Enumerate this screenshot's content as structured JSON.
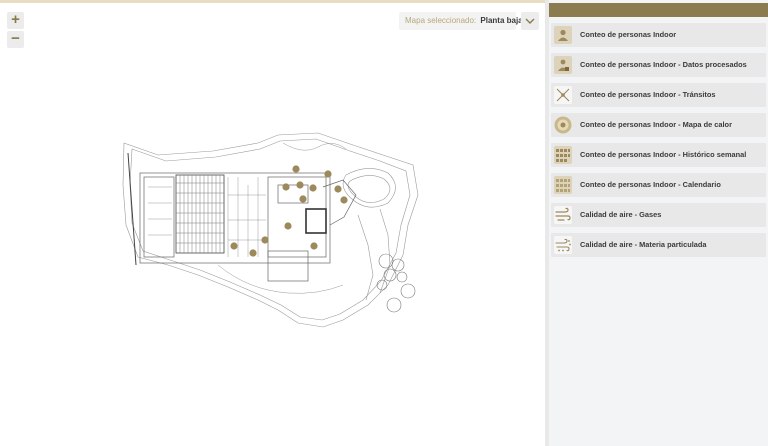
{
  "map": {
    "zoom_in_label": "+",
    "zoom_out_label": "−",
    "selector_label": "Mapa seleccionado:",
    "selector_value": "Planta baja"
  },
  "colors": {
    "accent": "#8c7b4e",
    "marker": "#9c8a5c",
    "panel_bg": "#f3f4f6",
    "item_bg": "#e8e8e9"
  },
  "menu": {
    "items": [
      {
        "label": "Conteo de personas Indoor",
        "icon": "person-count-icon"
      },
      {
        "label": "Conteo de personas Indoor - Datos procesados",
        "icon": "processed-data-icon"
      },
      {
        "label": "Conteo de personas Indoor - Tránsitos",
        "icon": "transit-arrows-icon"
      },
      {
        "label": "Conteo de personas Indoor - Mapa de calor",
        "icon": "heatmap-icon"
      },
      {
        "label": "Conteo de personas Indoor - Histórico semanal",
        "icon": "weekly-history-icon"
      },
      {
        "label": "Conteo de personas Indoor - Calendario",
        "icon": "calendar-icon"
      },
      {
        "label": "Calidad de aire - Gases",
        "icon": "air-gases-icon"
      },
      {
        "label": "Calidad de aire - Materia particulada",
        "icon": "particulate-matter-icon"
      }
    ]
  }
}
